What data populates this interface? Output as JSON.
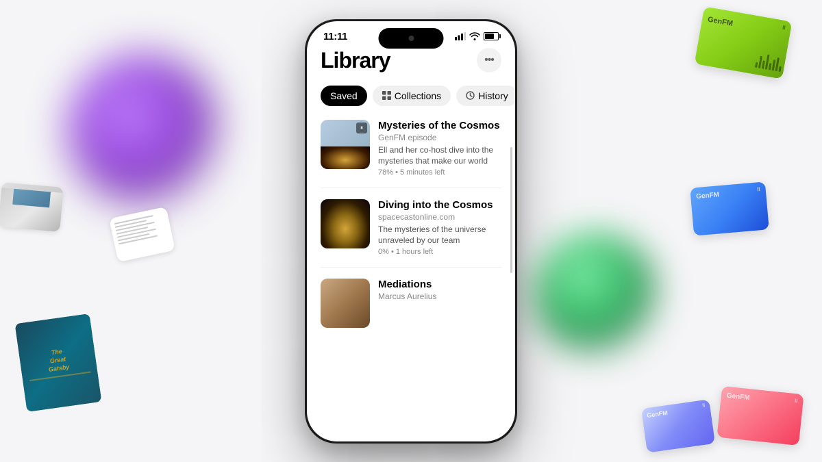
{
  "app": {
    "title": "Library",
    "more_button_label": "•••"
  },
  "status_bar": {
    "time": "11:11",
    "signal_icon": "▌▌▌",
    "wifi_icon": "wifi",
    "battery_level": 70
  },
  "tabs": [
    {
      "id": "saved",
      "label": "Saved",
      "active": true
    },
    {
      "id": "collections",
      "label": "Collections",
      "active": false
    },
    {
      "id": "history",
      "label": "History",
      "active": false
    }
  ],
  "episodes": [
    {
      "title": "Mysteries of the Cosmos",
      "source": "GenFM episode",
      "description": "Ell and her co-host dive into the mysteries that make our world",
      "progress": "78% • 5 minutes left",
      "thumb_type": "genfm_cosmos"
    },
    {
      "title": "Diving into the Cosmos",
      "source": "spacecastonline.com",
      "description": "The mysteries of the universe unraveled by our team",
      "progress": "0% • 1 hours left",
      "thumb_type": "galaxy"
    },
    {
      "title": "Mediations",
      "source": "Marcus Aurelius",
      "description": "",
      "progress": "",
      "thumb_type": "meditation"
    }
  ],
  "floating_cards": {
    "genfm_top_label": "GenFM",
    "genfm_mid_label": "GenFM",
    "genfm_bot_label": "GenFM",
    "genfm_bot2_label": "GenFM",
    "gatsby_title": "The\nGreat\nGatsby"
  }
}
